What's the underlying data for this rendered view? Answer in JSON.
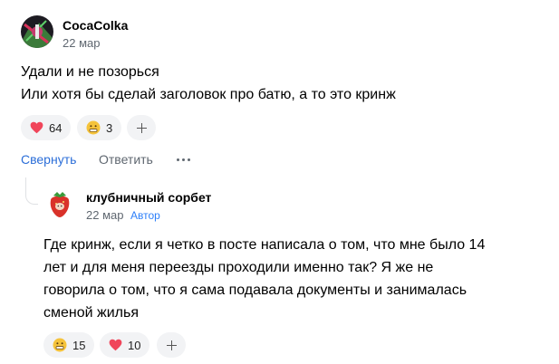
{
  "comment1": {
    "author": "CocaColka",
    "date": "22 мар",
    "lines": [
      "Удали и не позорься",
      "Или хотя бы сделай заголовок про батю, а то это кринж"
    ],
    "reactions": [
      {
        "icon": "heart-icon",
        "count": "64"
      },
      {
        "icon": "grimace-emoji-icon",
        "count": "3"
      }
    ],
    "actions": {
      "collapse": "Свернуть",
      "reply": "Ответить"
    }
  },
  "reply1": {
    "author": "клубничный сорбет",
    "date": "22 мар",
    "badge": "Автор",
    "lines": [
      "Где кринж, если я четко в посте написала о том, что мне было 14",
      "лет и для меня переезды проходили именно так? Я же не",
      "говорила о том, что я сама подавала документы и занималась",
      "сменой жилья"
    ],
    "reactions": [
      {
        "icon": "grimace-emoji-icon",
        "count": "15"
      },
      {
        "icon": "heart-icon",
        "count": "10"
      }
    ]
  },
  "colors": {
    "link": "#2b6ed8",
    "badge": "#2d7ff9",
    "muted": "#5f6770",
    "heart": "#f0455a",
    "emoji": "#f5c33b",
    "chip": "#f2f3f5"
  }
}
